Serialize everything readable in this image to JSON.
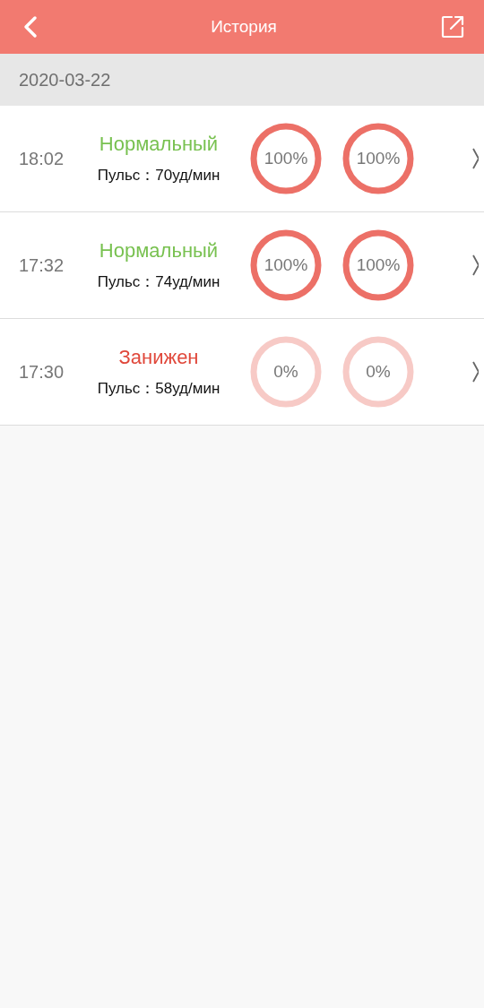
{
  "header": {
    "title": "История"
  },
  "date": "2020-03-22",
  "records": [
    {
      "time": "18:02",
      "status": "Нормальный",
      "kind": "normal",
      "pulse": "Пульс：70уд/мин",
      "rings": [
        {
          "label": "100%",
          "active": true
        },
        {
          "label": "100%",
          "active": true
        }
      ]
    },
    {
      "time": "17:32",
      "status": "Нормальный",
      "kind": "normal",
      "pulse": "Пульс：74уд/мин",
      "rings": [
        {
          "label": "100%",
          "active": true
        },
        {
          "label": "100%",
          "active": true
        }
      ]
    },
    {
      "time": "17:30",
      "status": "Занижен",
      "kind": "low",
      "pulse": "Пульс：58уд/мин",
      "rings": [
        {
          "label": "0%",
          "active": false
        },
        {
          "label": "0%",
          "active": false
        }
      ]
    }
  ]
}
